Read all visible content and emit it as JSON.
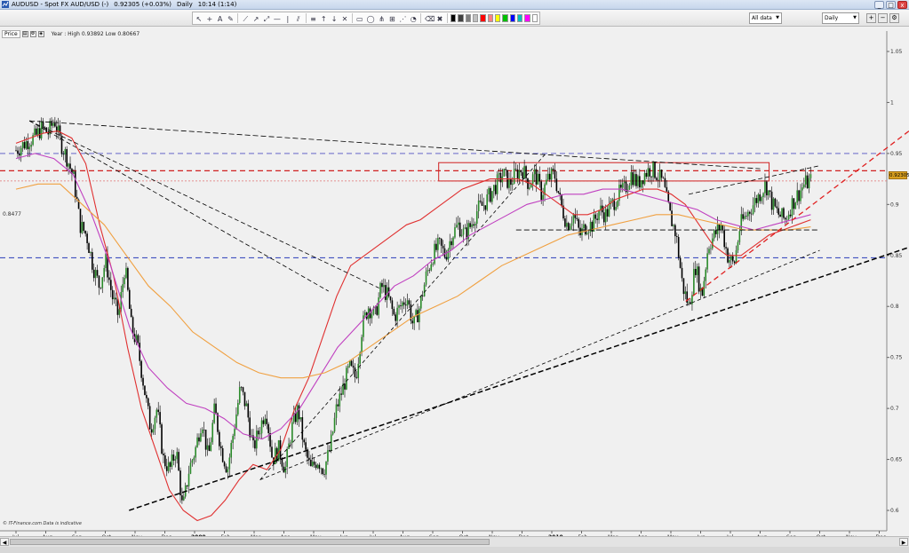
{
  "window": {
    "title": "AUDUSD - Spot FX AUD/USD (-)",
    "last_price": "0.92305 (+0.03%)",
    "interval": "Daily",
    "time": "10:14 (1:14)",
    "minimize": "_",
    "maximize": "□",
    "close": "x"
  },
  "toolbar": {
    "tools": [
      {
        "icon": "cursor-icon",
        "glyph": "↖"
      },
      {
        "icon": "crosshair-icon",
        "glyph": "+"
      },
      {
        "icon": "text-icon",
        "glyph": "A"
      },
      {
        "icon": "pencil-icon",
        "glyph": "✎"
      },
      {
        "icon": "trendline-icon",
        "glyph": "⟋"
      },
      {
        "icon": "ray-icon",
        "glyph": "↗"
      },
      {
        "icon": "extended-line-icon",
        "glyph": "⤢"
      },
      {
        "icon": "hline-icon",
        "glyph": "—"
      },
      {
        "icon": "vline-icon",
        "glyph": "|"
      },
      {
        "icon": "channel-icon",
        "glyph": "⫽"
      },
      {
        "icon": "fib-icon",
        "glyph": "≡"
      },
      {
        "icon": "arrow-up-icon",
        "glyph": "↑"
      },
      {
        "icon": "arrow-down-icon",
        "glyph": "↓"
      },
      {
        "icon": "gann-icon",
        "glyph": "✕"
      },
      {
        "icon": "rectangle-icon",
        "glyph": "▭"
      },
      {
        "icon": "ellipse-icon",
        "glyph": "◯"
      },
      {
        "icon": "pitchfork-icon",
        "glyph": "⋔"
      },
      {
        "icon": "measure-icon",
        "glyph": "⊞"
      },
      {
        "icon": "fan-icon",
        "glyph": "⋰"
      },
      {
        "icon": "cycle-icon",
        "glyph": "◔"
      },
      {
        "icon": "eraser-icon",
        "glyph": "⌫"
      },
      {
        "icon": "delete-icon",
        "glyph": "✖"
      }
    ],
    "swatches": [
      "#000000",
      "#404040",
      "#808080",
      "#c0c0c0",
      "#ff0000",
      "#ff8080",
      "#ffff00",
      "#00c000",
      "#0000ff",
      "#00c0c0",
      "#ff00ff",
      "#ffffff"
    ],
    "range_select": "All data",
    "period_select": "Daily"
  },
  "panel": {
    "label": "Price",
    "stats": "Year : High 0.93892 Low 0.80667",
    "hline_label": "0.8477",
    "current_price": "0.92305",
    "copyright": "© IT-Finance.com  Data is indicative"
  },
  "chart_data": {
    "type": "candlestick",
    "instrument": "AUDUSD",
    "ylim": [
      0.58,
      1.07
    ],
    "y_ticks": [
      {
        "label": "1.05",
        "value": 1.05
      },
      {
        "label": "1",
        "value": 1.0
      },
      {
        "label": "0.95",
        "value": 0.95
      },
      {
        "label": "0.9",
        "value": 0.9
      },
      {
        "label": "0.85",
        "value": 0.85
      },
      {
        "label": "0.8",
        "value": 0.8
      },
      {
        "label": "0.75",
        "value": 0.75
      },
      {
        "label": "0.7",
        "value": 0.7
      },
      {
        "label": "0.65",
        "value": 0.65
      },
      {
        "label": "0.6",
        "value": 0.6
      }
    ],
    "x_ticks": [
      "Jul",
      "Aug",
      "Sep",
      "Oct",
      "Nov",
      "Dec",
      "2009",
      "Feb",
      "Mar",
      "Apr",
      "May",
      "Jun",
      "Jul",
      "Aug",
      "Sep",
      "Oct",
      "Nov",
      "Dec",
      "2010",
      "Feb",
      "Mar",
      "Apr",
      "May",
      "Jun",
      "Jul",
      "Aug",
      "Sep",
      "Oct",
      "Nov",
      "Dec"
    ],
    "months_with_data": 27,
    "close_path": [
      0.953,
      0.958,
      0.963,
      0.966,
      0.975,
      0.97,
      0.983,
      0.96,
      0.945,
      0.925,
      0.88,
      0.87,
      0.84,
      0.82,
      0.845,
      0.81,
      0.79,
      0.84,
      0.78,
      0.76,
      0.72,
      0.68,
      0.7,
      0.65,
      0.64,
      0.66,
      0.6,
      0.64,
      0.66,
      0.69,
      0.65,
      0.7,
      0.66,
      0.64,
      0.68,
      0.72,
      0.7,
      0.66,
      0.68,
      0.7,
      0.65,
      0.66,
      0.64,
      0.68,
      0.7,
      0.66,
      0.64,
      0.65,
      0.64,
      0.66,
      0.7,
      0.72,
      0.74,
      0.73,
      0.78,
      0.8,
      0.79,
      0.82,
      0.81,
      0.79,
      0.8,
      0.81,
      0.78,
      0.8,
      0.83,
      0.85,
      0.86,
      0.85,
      0.87,
      0.88,
      0.87,
      0.88,
      0.895,
      0.9,
      0.91,
      0.92,
      0.93,
      0.92,
      0.93,
      0.935,
      0.92,
      0.93,
      0.91,
      0.925,
      0.93,
      0.9,
      0.88,
      0.89,
      0.87,
      0.88,
      0.88,
      0.895,
      0.89,
      0.9,
      0.91,
      0.915,
      0.93,
      0.92,
      0.93,
      0.935,
      0.93,
      0.92,
      0.89,
      0.87,
      0.82,
      0.8,
      0.84,
      0.81,
      0.86,
      0.87,
      0.88,
      0.85,
      0.84,
      0.88,
      0.89,
      0.9,
      0.91,
      0.92,
      0.9,
      0.89,
      0.885,
      0.9,
      0.91,
      0.92,
      0.923
    ],
    "moving_averages": [
      {
        "name": "",
        "color": "#e03030",
        "values": [
          0.96,
          0.965,
          0.97,
          0.972,
          0.965,
          0.94,
          0.88,
          0.83,
          0.76,
          0.7,
          0.66,
          0.62,
          0.6,
          0.59,
          0.595,
          0.61,
          0.63,
          0.645,
          0.64,
          0.66,
          0.7,
          0.73,
          0.77,
          0.81,
          0.84,
          0.85,
          0.86,
          0.87,
          0.88,
          0.885,
          0.895,
          0.905,
          0.915,
          0.92,
          0.925,
          0.925,
          0.925,
          0.92,
          0.91,
          0.9,
          0.89,
          0.89,
          0.895,
          0.905,
          0.91,
          0.915,
          0.915,
          0.91,
          0.9,
          0.88,
          0.86,
          0.85,
          0.85,
          0.86,
          0.87,
          0.875,
          0.88,
          0.885
        ]
      },
      {
        "name": "",
        "color": "#c040c0",
        "values": [
          0.945,
          0.95,
          0.945,
          0.93,
          0.89,
          0.84,
          0.78,
          0.74,
          0.72,
          0.705,
          0.7,
          0.69,
          0.675,
          0.67,
          0.68,
          0.7,
          0.73,
          0.76,
          0.78,
          0.8,
          0.82,
          0.83,
          0.845,
          0.855,
          0.87,
          0.88,
          0.89,
          0.9,
          0.905,
          0.91,
          0.91,
          0.915,
          0.915,
          0.91,
          0.905,
          0.9,
          0.895,
          0.885,
          0.88,
          0.875,
          0.88,
          0.885,
          0.89
        ]
      },
      {
        "name": "",
        "color": "#f0a040",
        "values": [
          0.915,
          0.92,
          0.92,
          0.9,
          0.88,
          0.85,
          0.82,
          0.8,
          0.775,
          0.76,
          0.745,
          0.735,
          0.73,
          0.73,
          0.735,
          0.745,
          0.76,
          0.775,
          0.79,
          0.8,
          0.81,
          0.825,
          0.84,
          0.85,
          0.86,
          0.87,
          0.875,
          0.88,
          0.885,
          0.89,
          0.89,
          0.885,
          0.88,
          0.875,
          0.875,
          0.875,
          0.878
        ]
      }
    ],
    "horizontal_lines": [
      {
        "value": 0.95,
        "color": "#8080d0",
        "style": "dashed"
      },
      {
        "value": 0.8477,
        "color": "#4050c0",
        "style": "dashed"
      },
      {
        "value": 0.923,
        "color": "#e07070",
        "style": "dotted"
      },
      {
        "value": 0.933,
        "color": "#d02020",
        "style": "dashed"
      }
    ],
    "resistance_zone": {
      "from": 0.923,
      "to": 0.941,
      "color": "#d02020"
    },
    "grid": false
  }
}
